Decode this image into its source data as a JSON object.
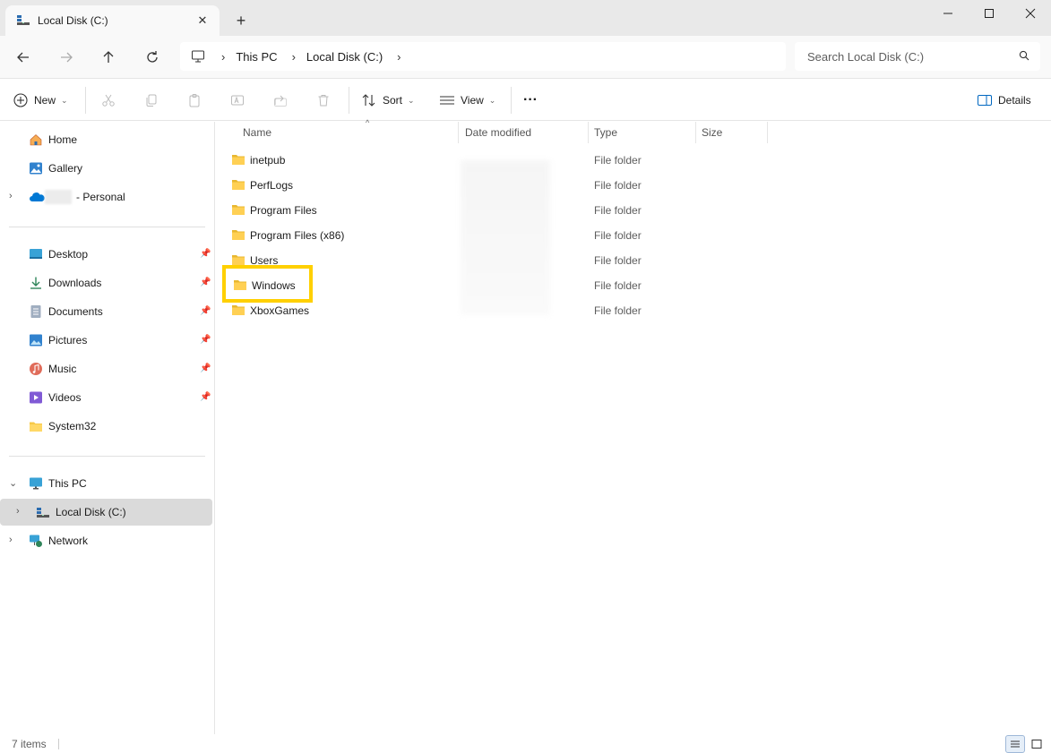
{
  "window": {
    "tab_title": "Local Disk (C:)",
    "new_tab_label": "+"
  },
  "address": {
    "crumbs": [
      "This PC",
      "Local Disk (C:)"
    ],
    "search_placeholder": "Search Local Disk (C:)"
  },
  "toolbar": {
    "new_label": "New",
    "sort_label": "Sort",
    "view_label": "View",
    "more_label": "···",
    "details_label": "Details"
  },
  "sidebar": {
    "quick": [
      {
        "label": "Home",
        "icon": "home-icon"
      },
      {
        "label": "Gallery",
        "icon": "gallery-icon"
      },
      {
        "label": "- Personal",
        "icon": "onedrive-icon"
      }
    ],
    "pinned": [
      {
        "label": "Desktop",
        "icon": "desktop-icon"
      },
      {
        "label": "Downloads",
        "icon": "downloads-icon"
      },
      {
        "label": "Documents",
        "icon": "documents-icon"
      },
      {
        "label": "Pictures",
        "icon": "pictures-icon"
      },
      {
        "label": "Music",
        "icon": "music-icon"
      },
      {
        "label": "Videos",
        "icon": "videos-icon"
      },
      {
        "label": "System32",
        "icon": "folder-icon"
      }
    ],
    "tree": [
      {
        "label": "This PC",
        "icon": "this-pc-icon"
      },
      {
        "label": "Local Disk (C:)",
        "icon": "drive-icon"
      },
      {
        "label": "Network",
        "icon": "network-icon"
      }
    ]
  },
  "columns": {
    "name": "Name",
    "date_modified": "Date modified",
    "type": "Type",
    "size": "Size"
  },
  "files": [
    {
      "name": "inetpub",
      "type": "File folder"
    },
    {
      "name": "PerfLogs",
      "type": "File folder"
    },
    {
      "name": "Program Files",
      "type": "File folder"
    },
    {
      "name": "Program Files (x86)",
      "type": "File folder"
    },
    {
      "name": "Users",
      "type": "File folder"
    },
    {
      "name": "Windows",
      "type": "File folder"
    },
    {
      "name": "XboxGames",
      "type": "File folder"
    }
  ],
  "status": {
    "item_count": "7 items"
  },
  "colors": {
    "accent": "#0067c0",
    "folder": "#f7c948",
    "highlight": "#ffd000"
  }
}
